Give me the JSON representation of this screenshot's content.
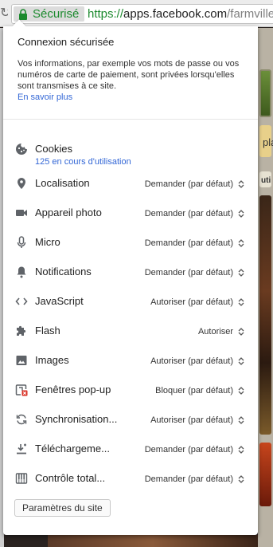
{
  "addressbar": {
    "reload_glyph": "↻",
    "secure_label": "Sécurisé",
    "url_scheme": "https://",
    "url_host": "apps.facebook.com",
    "url_path": "/farmville-"
  },
  "background": {
    "right_text_1": "pla",
    "right_text_2": "uti"
  },
  "popup": {
    "title": "Connexion sécurisée",
    "description": "Vos informations, par exemple vos mots de passe ou vos numéros de carte de paiement, sont privées lorsqu'elles sont transmises à ce site.",
    "learn_more": "En savoir plus",
    "site_settings_button": "Paramètres du site",
    "permissions": [
      {
        "icon": "cookie-icon",
        "label": "Cookies",
        "sub": "125 en cours d'utilisation",
        "value": ""
      },
      {
        "icon": "location-pin-icon",
        "label": "Localisation",
        "value": "Demander (par défaut)"
      },
      {
        "icon": "camera-icon",
        "label": "Appareil photo",
        "value": "Demander (par défaut)"
      },
      {
        "icon": "microphone-icon",
        "label": "Micro",
        "value": "Demander (par défaut)"
      },
      {
        "icon": "bell-icon",
        "label": "Notifications",
        "value": "Demander (par défaut)"
      },
      {
        "icon": "code-icon",
        "label": "JavaScript",
        "value": "Autoriser (par défaut)"
      },
      {
        "icon": "puzzle-icon",
        "label": "Flash",
        "value": "Autoriser"
      },
      {
        "icon": "image-icon",
        "label": "Images",
        "value": "Autoriser (par défaut)"
      },
      {
        "icon": "popup-blocked-icon",
        "label": "Fenêtres pop-up",
        "value": "Bloquer (par défaut)"
      },
      {
        "icon": "sync-icon",
        "label": "Synchronisation...",
        "value": "Autoriser (par défaut)"
      },
      {
        "icon": "download-icon",
        "label": "Téléchargeme...",
        "value": "Demander (par défaut)"
      },
      {
        "icon": "midi-icon",
        "label": "Contrôle total...",
        "value": "Demander (par défaut)"
      }
    ]
  },
  "colors": {
    "secure_green": "#1c8a2e",
    "link_blue": "#3367d6",
    "blocked_red": "#d93025"
  }
}
